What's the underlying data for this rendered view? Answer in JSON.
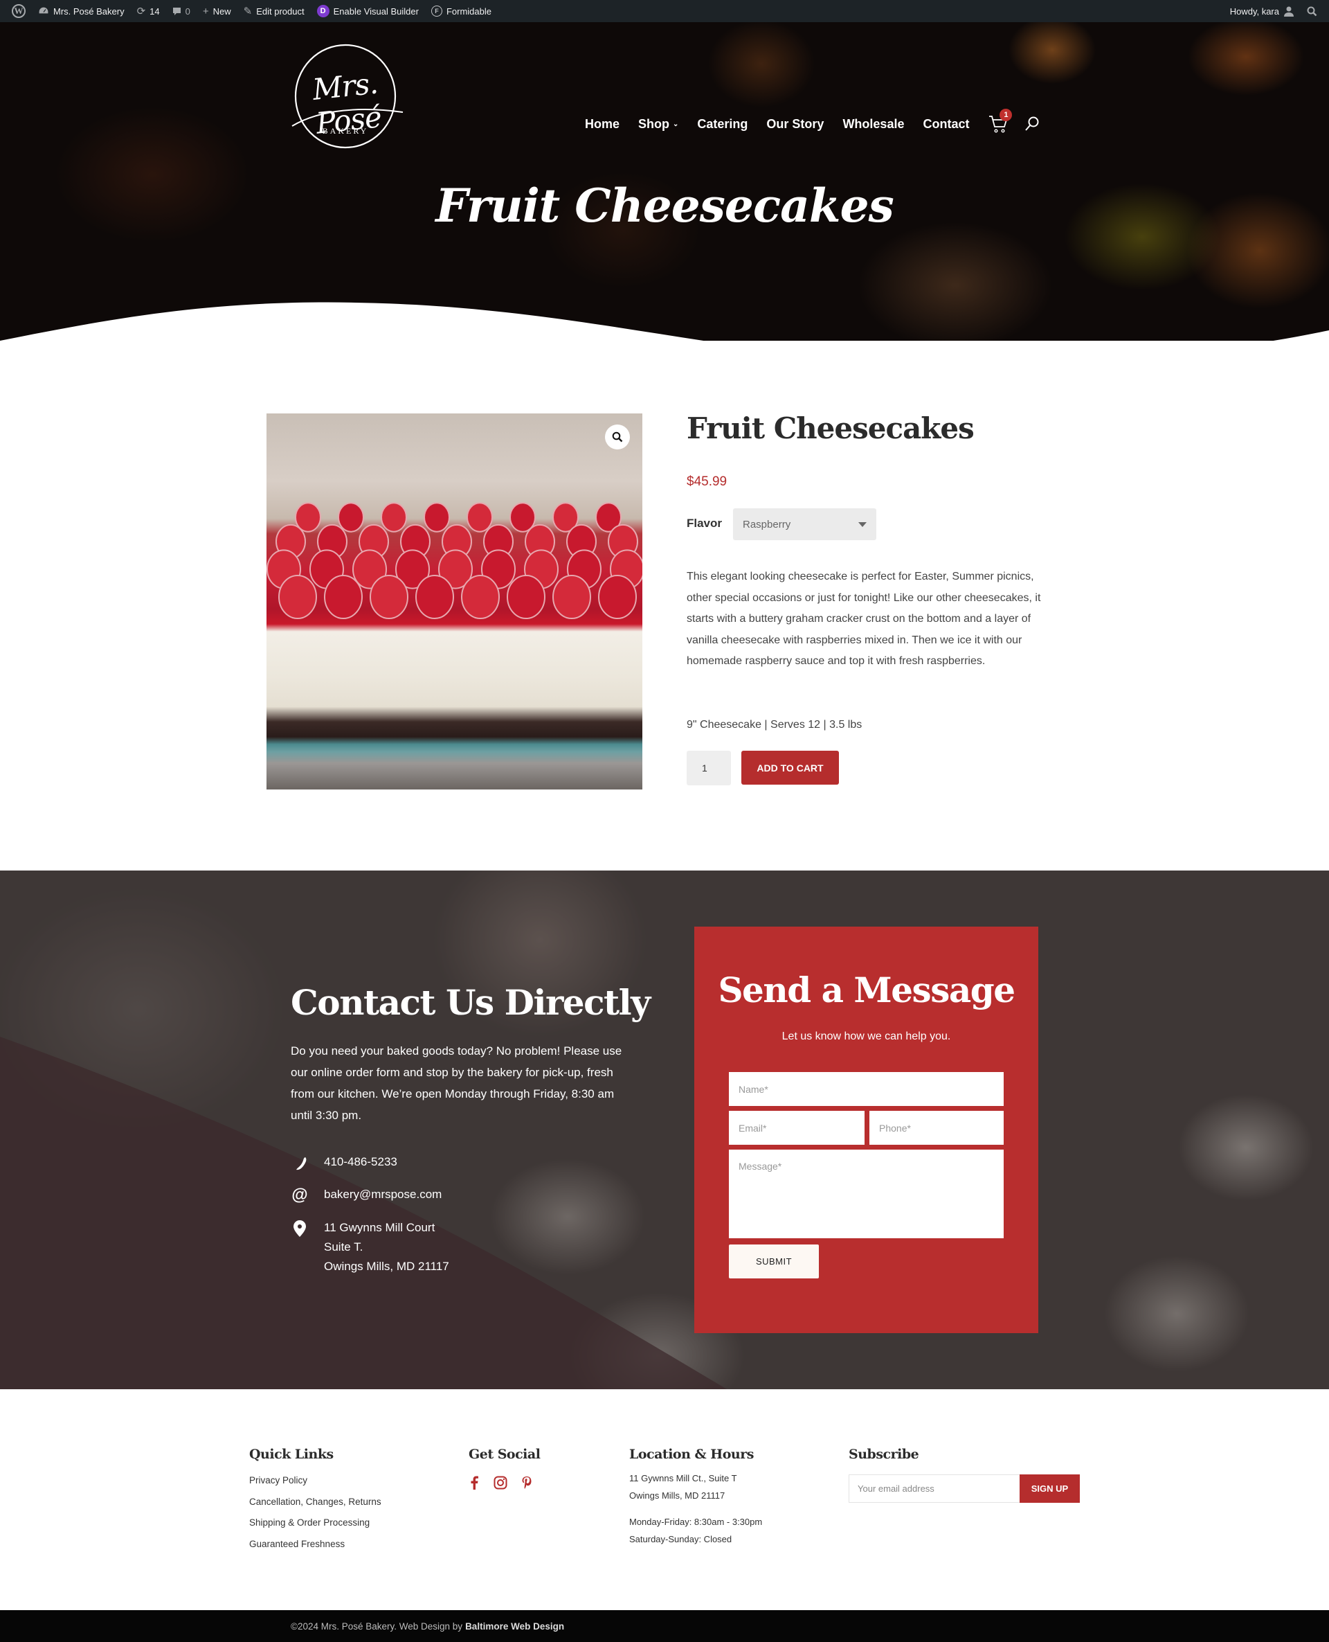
{
  "admin_bar": {
    "site_name": "Mrs. Posé Bakery",
    "updates_count": "14",
    "comments_count": "0",
    "new_label": "New",
    "edit_label": "Edit product",
    "visual_builder_label": "Enable Visual Builder",
    "divi_letter": "D",
    "formidable_label": "Formidable",
    "greeting": "Howdy, kara"
  },
  "header": {
    "logo_script": "Mrs. Posé",
    "logo_sub": "BAKERY",
    "nav": [
      {
        "label": "Home"
      },
      {
        "label": "Shop",
        "has_dropdown": true
      },
      {
        "label": "Catering"
      },
      {
        "label": "Our Story"
      },
      {
        "label": "Wholesale"
      },
      {
        "label": "Contact"
      }
    ],
    "cart_count": "1",
    "hero_title": "Fruit Cheesecakes"
  },
  "product": {
    "title": "Fruit Cheesecakes",
    "price": "$45.99",
    "flavor_label": "Flavor",
    "flavor_selected": "Raspberry",
    "description": "This elegant looking cheesecake is perfect for Easter, Summer picnics, other special occasions or just for tonight! Like our other cheesecakes, it starts with a buttery graham cracker crust on the bottom and a layer of vanilla cheesecake with raspberries mixed in. Then we ice it with our homemade raspberry sauce and top it with fresh raspberries.",
    "specs": "9\" Cheesecake | Serves 12 | 3.5 lbs",
    "quantity": "1",
    "add_to_cart_label": "ADD TO CART"
  },
  "contact": {
    "title": "Contact Us Directly",
    "text": "Do you need your baked goods today? No problem! Please use our online order form and stop by the bakery for pick-up, fresh from our kitchen. We’re open Monday through Friday, 8:30 am until 3:30 pm.",
    "phone": "410-486-5233",
    "email": "bakery@mrspose.com",
    "address": [
      "11 Gwynns Mill Court",
      "Suite T.",
      "Owings Mills, MD 21117"
    ]
  },
  "form": {
    "title": "Send a Message",
    "subtitle": "Let us know how we can help you.",
    "name_placeholder": "Name*",
    "email_placeholder": "Email*",
    "phone_placeholder": "Phone*",
    "message_placeholder": "Message*",
    "submit_label": "SUBMIT"
  },
  "footer": {
    "quick_links_heading": "Quick Links",
    "quick_links": [
      "Privacy Policy",
      "Cancellation, Changes, Returns",
      "Shipping & Order Processing",
      "Guaranteed Freshness"
    ],
    "social_heading": "Get Social",
    "social_icons": [
      "facebook-icon",
      "instagram-icon",
      "pinterest-icon"
    ],
    "location_heading": "Location & Hours",
    "location_lines": [
      "11 Gywnns Mill Ct., Suite T",
      "Owings Mills, MD 21117"
    ],
    "hours_lines": [
      "Monday-Friday: 8:30am - 3:30pm",
      "Saturday-Sunday: Closed"
    ],
    "subscribe_heading": "Subscribe",
    "subscribe_placeholder": "Your email address",
    "subscribe_button": "SIGN UP",
    "copyright": "©2024 Mrs. Posé Bakery. Web Design by",
    "credit": "Baltimore Web Design"
  },
  "colors": {
    "brand_red": "#b52d2d",
    "admin_bar": "#1d2327",
    "footer_bottom": "#060606"
  }
}
